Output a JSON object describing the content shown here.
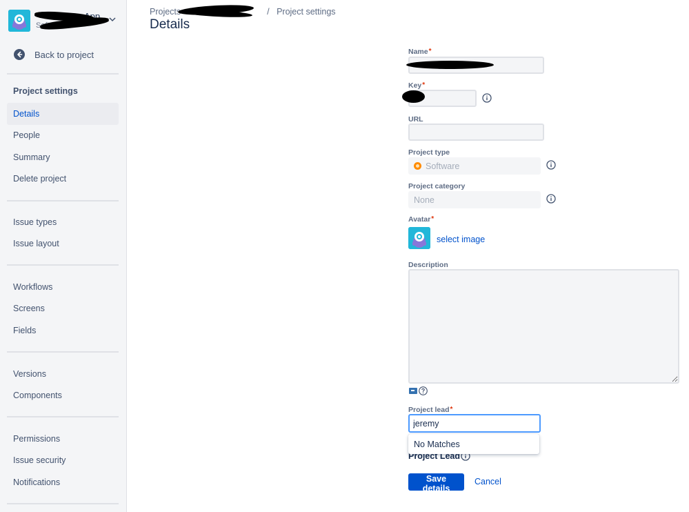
{
  "sidebar": {
    "project_name": "App",
    "project_sub": "Soft",
    "back_label": "Back to project",
    "heading": "Project settings",
    "items": [
      {
        "label": "Details"
      },
      {
        "label": "People"
      },
      {
        "label": "Summary"
      },
      {
        "label": "Delete project"
      },
      {
        "label": "Issue types"
      },
      {
        "label": "Issue layout"
      },
      {
        "label": "Workflows"
      },
      {
        "label": "Screens"
      },
      {
        "label": "Fields"
      },
      {
        "label": "Versions"
      },
      {
        "label": "Components"
      },
      {
        "label": "Permissions"
      },
      {
        "label": "Issue security"
      },
      {
        "label": "Notifications"
      }
    ]
  },
  "breadcrumb": {
    "root": "Projects",
    "separator": "/",
    "current": "Project settings"
  },
  "page": {
    "title": "Details"
  },
  "form": {
    "name_label": "Name",
    "key_label": "Key",
    "url_label": "URL",
    "type_label": "Project type",
    "type_value": "Software",
    "category_label": "Project category",
    "category_value": "None",
    "avatar_label": "Avatar",
    "select_image": "select image",
    "description_label": "Description",
    "lead_label": "Project lead",
    "lead_value": "jeremy",
    "dropdown_text": "No Matches",
    "project_lead_heading": "Project Lead",
    "required_marker": "*",
    "save_label": "Save details",
    "cancel_label": "Cancel"
  },
  "colors": {
    "accent": "#0052cc",
    "sidebar_bg": "#f4f5f7",
    "required": "#de350b",
    "avatar_bg": "#21b7d9"
  }
}
